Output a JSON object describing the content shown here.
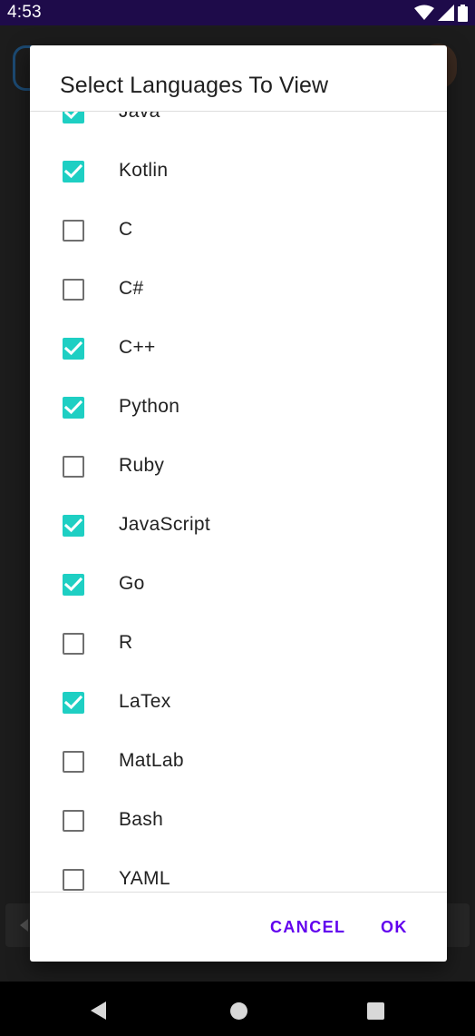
{
  "status_bar": {
    "time": "4:53",
    "icons": [
      "wifi-icon",
      "signal-icon",
      "battery-icon"
    ]
  },
  "dialog": {
    "title": "Select Languages To View",
    "options": [
      {
        "label": "Java",
        "checked": true
      },
      {
        "label": "Kotlin",
        "checked": true
      },
      {
        "label": "C",
        "checked": false
      },
      {
        "label": "C#",
        "checked": false
      },
      {
        "label": "C++",
        "checked": true
      },
      {
        "label": "Python",
        "checked": true
      },
      {
        "label": "Ruby",
        "checked": false
      },
      {
        "label": "JavaScript",
        "checked": true
      },
      {
        "label": "Go",
        "checked": true
      },
      {
        "label": "R",
        "checked": false
      },
      {
        "label": "LaTex",
        "checked": true
      },
      {
        "label": "MatLab",
        "checked": false
      },
      {
        "label": "Bash",
        "checked": false
      },
      {
        "label": "YAML",
        "checked": false
      }
    ],
    "cancel_label": "CANCEL",
    "ok_label": "OK"
  },
  "colors": {
    "checkbox_checked": "#1ecfc3",
    "button_text": "#6200ee",
    "status_bar": "#1e0b4a"
  },
  "nav_bar": {
    "icons": [
      "back-icon",
      "home-icon",
      "recents-icon"
    ]
  }
}
